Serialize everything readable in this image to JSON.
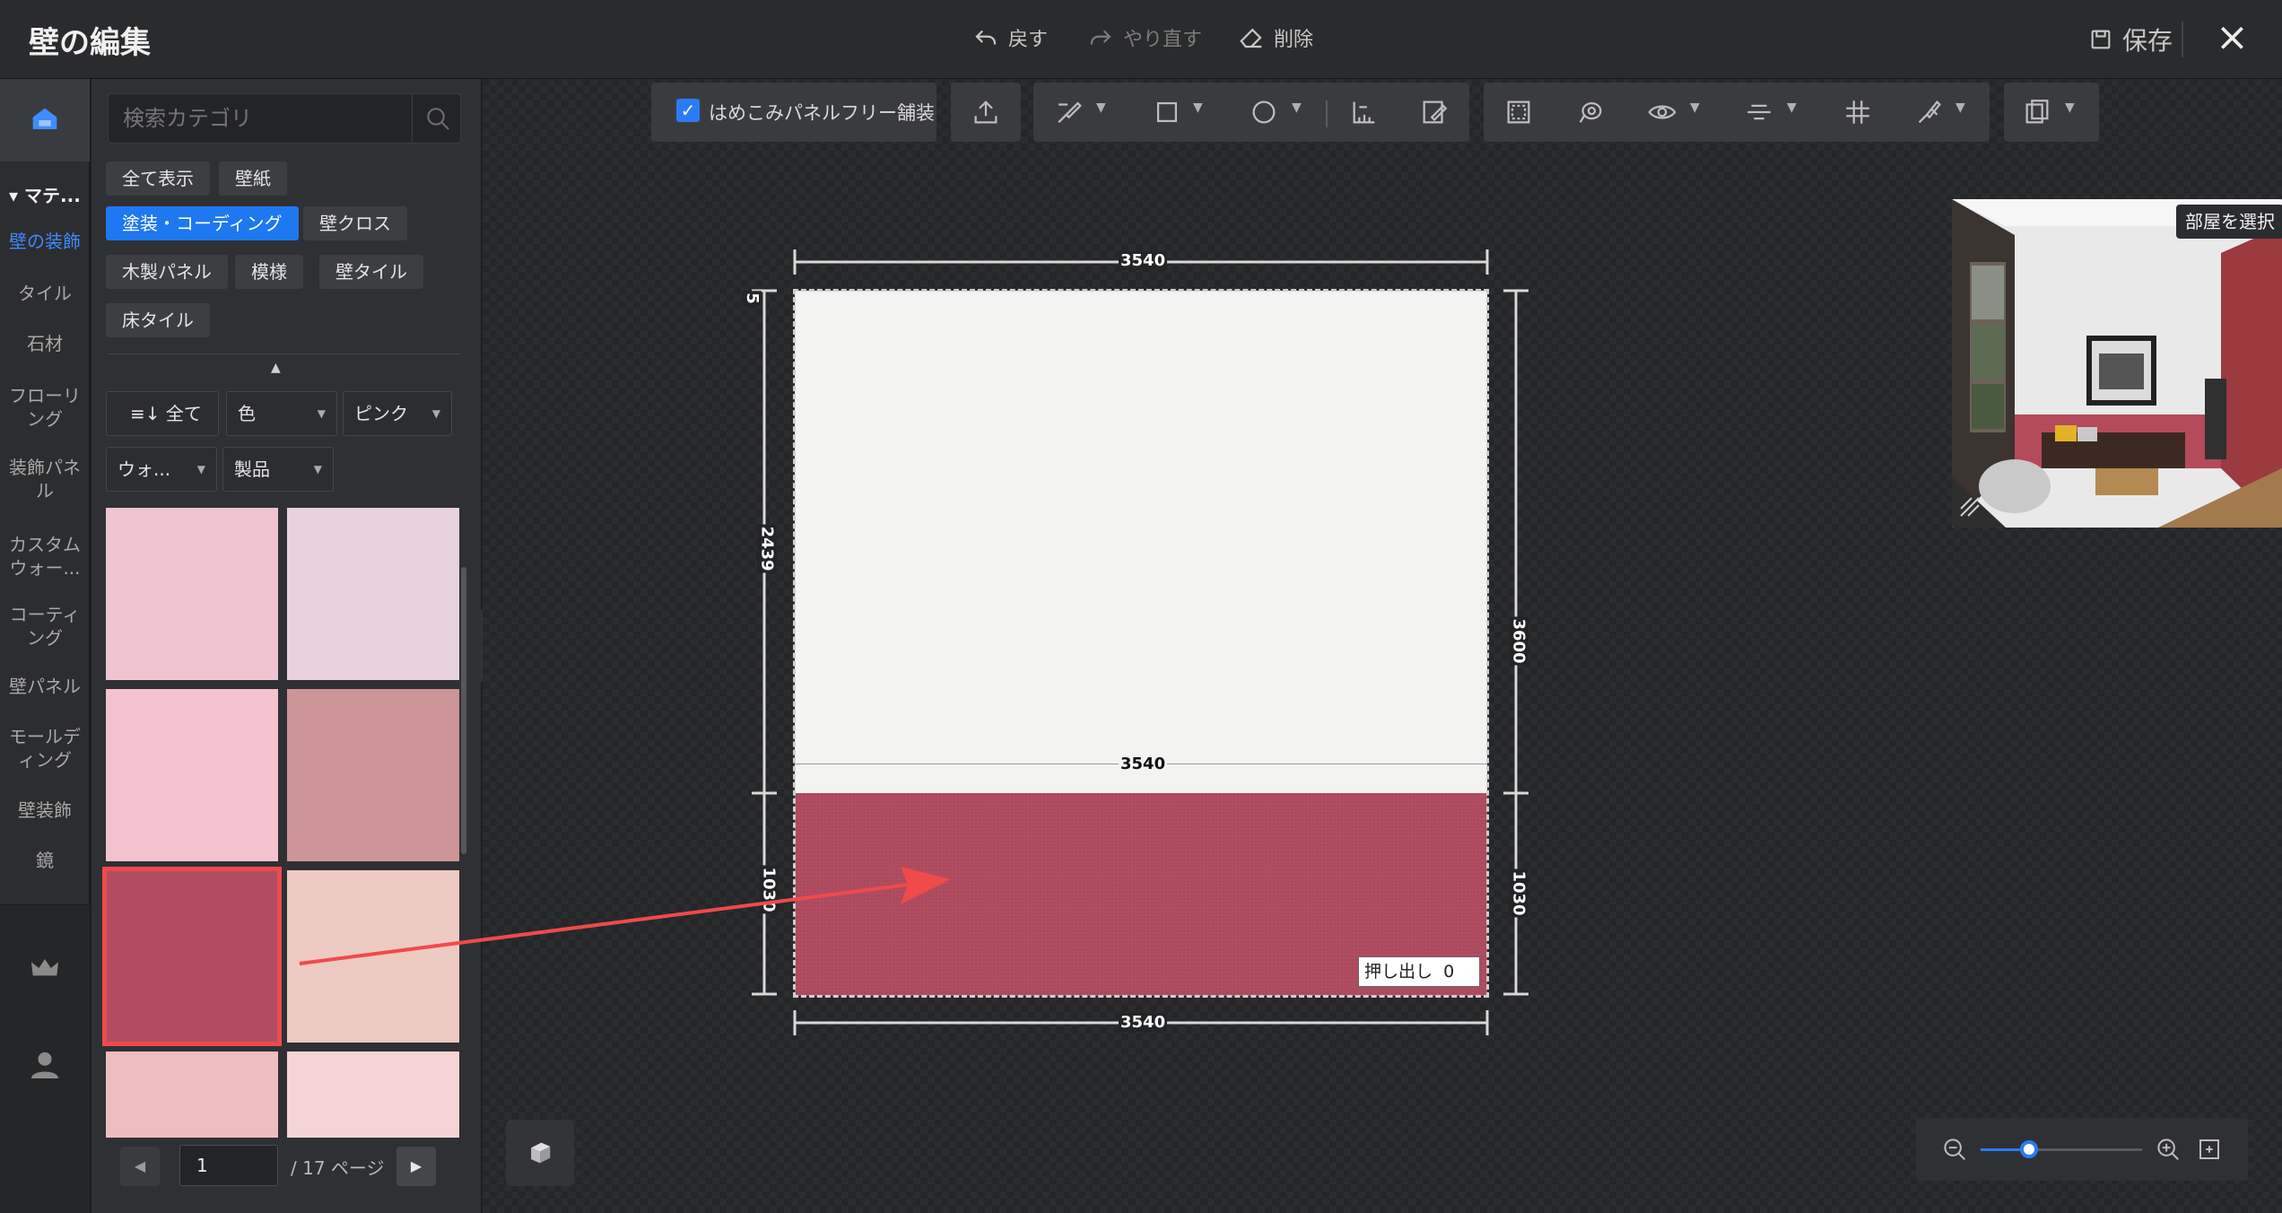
{
  "header": {
    "title": "壁の編集",
    "undo_label": "戻す",
    "redo_label": "やり直す",
    "delete_label": "削除",
    "save_label": "保存"
  },
  "rail": {
    "section_label": "マテ...",
    "items": [
      {
        "label": "壁の装飾",
        "active": true
      },
      {
        "label": "タイル"
      },
      {
        "label": "石材"
      },
      {
        "label": "フローリング"
      },
      {
        "label": "装飾パネル"
      },
      {
        "label": "カスタムウォー..."
      },
      {
        "label": "コーティング"
      },
      {
        "label": "壁パネル"
      },
      {
        "label": "モールディング"
      },
      {
        "label": "壁装飾"
      },
      {
        "label": "鏡"
      }
    ],
    "bottom_icons": [
      "crown-icon",
      "user-icon"
    ]
  },
  "panel": {
    "search_placeholder": "検索カテゴリ",
    "chips": [
      {
        "label": "全て表示"
      },
      {
        "label": "壁紙"
      },
      {
        "label": "塗装・コーディング",
        "active": true
      },
      {
        "label": "壁クロス"
      },
      {
        "label": "木製パネル"
      },
      {
        "label": "模様"
      },
      {
        "label": "壁タイル"
      },
      {
        "label": "床タイル"
      }
    ],
    "filters": {
      "sort_label": "全て",
      "color_label": "色",
      "color_value": "ピンク",
      "wall_label": "ウォ...",
      "product_label": "製品"
    },
    "swatches": [
      "#efc4d0",
      "#e6d3dc",
      "#f4c1cf",
      "#cc9598",
      "#b04d60",
      "#edcac2",
      "#eebdc0",
      "#f4d4d4"
    ],
    "selected_swatch": 4,
    "pager": {
      "current_page": "1",
      "total_label": "/ 17 ページ"
    }
  },
  "toolbar": {
    "checkbox_label": "はめこみパネルフリー舗装",
    "checkbox_checked": true
  },
  "wall": {
    "top_width": "3540",
    "middle_width": "3540",
    "bottom_width": "3540",
    "upper_height": "2439",
    "total_height": "3600",
    "lower_height_left": "1030",
    "lower_height_right": "1030",
    "top_offset": "5",
    "extrude_label": "押し出し",
    "extrude_value": "0",
    "upper_color": "#f3f3f2",
    "lower_color": "#b04d60"
  },
  "preview": {
    "room_select_label": "部屋を選択"
  },
  "zoom": {
    "level": 0.3
  },
  "colors": {
    "accent": "#1e78f0",
    "annotation_red": "#f04a4a"
  }
}
